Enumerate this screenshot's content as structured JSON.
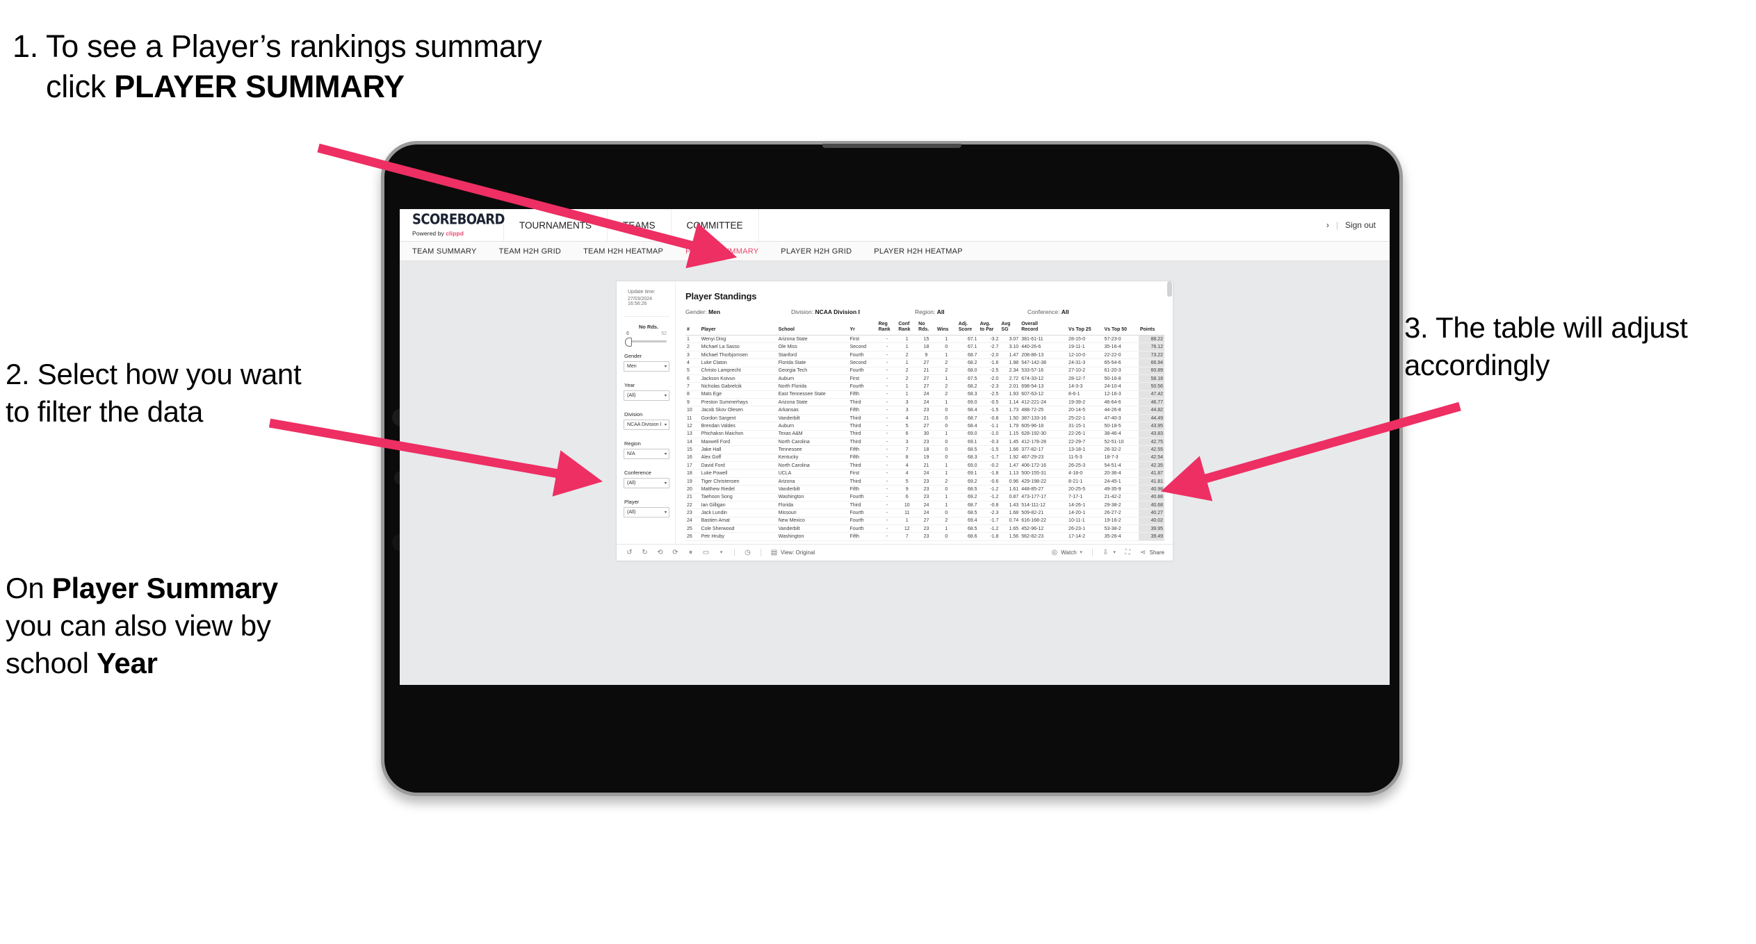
{
  "annotations": {
    "step1": {
      "number": "1.",
      "text_plain_a": "To see a Player’s rankings summary click ",
      "text_bold_a": "PLAYER SUMMARY"
    },
    "step2": {
      "line1": "2. Select how you want to filter the data",
      "p2_a": "On ",
      "p2_b": "Player Summary",
      "p2_c": " you can also view by school ",
      "p2_d": "Year"
    },
    "step3": {
      "text": "3. The table will adjust accordingly"
    },
    "arrow_color": "#ed2f63"
  },
  "app": {
    "brand": {
      "logo": "SCOREBOARD",
      "powered_prefix": "Powered by ",
      "powered_brand": "clippd"
    },
    "nav_tabs": [
      {
        "label": "TOURNAMENTS"
      },
      {
        "label": "TEAMS"
      },
      {
        "label": "COMMITTEE"
      }
    ],
    "account": {
      "chevron": "›",
      "separator": "|",
      "sign_out": "Sign out"
    },
    "sub_tabs": [
      {
        "label": "TEAM SUMMARY",
        "active": false
      },
      {
        "label": "TEAM H2H GRID",
        "active": false
      },
      {
        "label": "TEAM H2H HEATMAP",
        "active": false
      },
      {
        "label": "PLAYER SUMMARY",
        "active": true
      },
      {
        "label": "PLAYER H2H GRID",
        "active": false
      },
      {
        "label": "PLAYER H2H HEATMAP",
        "active": false
      }
    ],
    "accent_color": "#e8476f"
  },
  "viz": {
    "update": {
      "label": "Update time:",
      "value": "27/03/2024 16:56:26"
    },
    "title": "Player Standings",
    "meta": [
      {
        "label": "Gender:",
        "value": "Men"
      },
      {
        "label": "Division:",
        "value": "NCAA Division I"
      },
      {
        "label": "Region:",
        "value": "All"
      },
      {
        "label": "Conference:",
        "value": "All"
      }
    ],
    "filters": {
      "slider": {
        "label": "No Rds.",
        "min": "6",
        "max": "52"
      },
      "selects": [
        {
          "label": "Gender",
          "value": "Men"
        },
        {
          "label": "Year",
          "value": "(All)"
        },
        {
          "label": "Division",
          "value": "NCAA Division I"
        },
        {
          "label": "Region",
          "value": "N/A"
        },
        {
          "label": "Conference",
          "value": "(All)"
        },
        {
          "label": "Player",
          "value": "(All)"
        }
      ]
    },
    "bottom_bar": {
      "view_label": "View: Original",
      "watch_label": "Watch",
      "share_label": "Share"
    }
  },
  "chart_data": {
    "type": "table",
    "title": "Player Standings",
    "columns": [
      "#",
      "Player",
      "School",
      "Yr",
      "Reg Rank",
      "Conf Rank",
      "No Rds.",
      "Wins",
      "Adj. Score",
      "Avg. to Par",
      "Avg SG",
      "Overall Record",
      "Vs Top 25",
      "Vs Top 50",
      "Points"
    ],
    "rows": [
      [
        "1",
        "Wenyi Ding",
        "Arizona State",
        "First",
        "-",
        "1",
        "15",
        "1",
        "67.1",
        "-3.2",
        "3.07",
        "381-61-11",
        "28-15-0",
        "57-23-0",
        "88.22"
      ],
      [
        "2",
        "Michael La Sasso",
        "Ole Miss",
        "Second",
        "-",
        "1",
        "18",
        "0",
        "67.1",
        "-2.7",
        "3.10",
        "440-26-6",
        "19-11-1",
        "35-16-4",
        "76.12"
      ],
      [
        "3",
        "Michael Thorbjornsen",
        "Stanford",
        "Fourth",
        "-",
        "2",
        "9",
        "1",
        "68.7",
        "-2.0",
        "1.47",
        "208-86-13",
        "12-10-0",
        "22-22-0",
        "73.22"
      ],
      [
        "4",
        "Luke Claton",
        "Florida State",
        "Second",
        "-",
        "1",
        "27",
        "2",
        "68.2",
        "-1.6",
        "1.98",
        "547-142-38",
        "24-31-3",
        "65-54-6",
        "66.94"
      ],
      [
        "5",
        "Christo Lamprecht",
        "Georgia Tech",
        "Fourth",
        "-",
        "2",
        "21",
        "2",
        "68.0",
        "-2.5",
        "2.34",
        "533-57-16",
        "27-10-2",
        "61-20-3",
        "60.89"
      ],
      [
        "6",
        "Jackson Koivun",
        "Auburn",
        "First",
        "-",
        "2",
        "27",
        "1",
        "67.5",
        "-2.0",
        "2.72",
        "674-33-12",
        "28-12-7",
        "50-16-8",
        "58.18"
      ],
      [
        "7",
        "Nicholas Gabrelcik",
        "North Florida",
        "Fourth",
        "-",
        "1",
        "27",
        "2",
        "68.2",
        "-2.3",
        "2.01",
        "698-54-13",
        "14-3-3",
        "24-10-4",
        "50.56"
      ],
      [
        "8",
        "Mats Ege",
        "East Tennessee State",
        "Fifth",
        "-",
        "1",
        "24",
        "2",
        "68.3",
        "-2.5",
        "1.93",
        "607-63-12",
        "8-6-1",
        "12-16-3",
        "47.42"
      ],
      [
        "9",
        "Preston Summerhays",
        "Arizona State",
        "Third",
        "-",
        "3",
        "24",
        "1",
        "69.0",
        "-0.5",
        "1.14",
        "412-221-24",
        "19-39-2",
        "46-64-6",
        "46.77"
      ],
      [
        "10",
        "Jacob Skov Olesen",
        "Arkansas",
        "Fifth",
        "-",
        "3",
        "23",
        "0",
        "68.4",
        "-1.5",
        "1.73",
        "488-72-25",
        "20-14-5",
        "44-26-8",
        "44.82"
      ],
      [
        "11",
        "Gordon Sargent",
        "Vanderbilt",
        "Third",
        "-",
        "4",
        "21",
        "0",
        "68.7",
        "-0.8",
        "1.50",
        "387-133-16",
        "25-22-1",
        "47-40-3",
        "44.49"
      ],
      [
        "12",
        "Brendan Valdes",
        "Auburn",
        "Third",
        "-",
        "5",
        "27",
        "0",
        "68.4",
        "-1.1",
        "1.79",
        "605-96-18",
        "31-15-1",
        "50-18-5",
        "43.95"
      ],
      [
        "13",
        "Phichaksn Maichon",
        "Texas A&M",
        "Third",
        "-",
        "6",
        "30",
        "1",
        "69.0",
        "-1.0",
        "1.15",
        "628-192-30",
        "22-26-1",
        "38-46-4",
        "43.83"
      ],
      [
        "14",
        "Maxwell Ford",
        "North Carolina",
        "Third",
        "-",
        "3",
        "23",
        "0",
        "69.1",
        "-0.3",
        "1.45",
        "412-178-28",
        "22-29-7",
        "52-51-10",
        "42.75"
      ],
      [
        "15",
        "Jake Hall",
        "Tennessee",
        "Fifth",
        "-",
        "7",
        "18",
        "0",
        "68.5",
        "-1.5",
        "1.66",
        "377-82-17",
        "13-18-1",
        "26-32-2",
        "42.55"
      ],
      [
        "16",
        "Alex Goff",
        "Kentucky",
        "Fifth",
        "-",
        "8",
        "19",
        "0",
        "68.3",
        "-1.7",
        "1.92",
        "467-29-23",
        "11-5-3",
        "18-7-3",
        "42.54"
      ],
      [
        "17",
        "David Ford",
        "North Carolina",
        "Third",
        "-",
        "4",
        "21",
        "1",
        "69.0",
        "-0.2",
        "1.47",
        "406-172-16",
        "26-25-3",
        "54-51-4",
        "42.35"
      ],
      [
        "18",
        "Luke Powell",
        "UCLA",
        "First",
        "-",
        "4",
        "24",
        "1",
        "69.1",
        "-1.8",
        "1.13",
        "500-155-31",
        "4-18-0",
        "20-36-4",
        "41.87"
      ],
      [
        "19",
        "Tiger Christensen",
        "Arizona",
        "Third",
        "-",
        "5",
        "23",
        "2",
        "69.2",
        "-0.6",
        "0.96",
        "429-198-22",
        "8-21-1",
        "24-45-1",
        "41.81"
      ],
      [
        "20",
        "Matthew Riedel",
        "Vanderbilt",
        "Fifth",
        "-",
        "9",
        "23",
        "0",
        "68.5",
        "-1.2",
        "1.61",
        "448-85-27",
        "20-25-5",
        "49-35-9",
        "40.98"
      ],
      [
        "21",
        "Taehoon Song",
        "Washington",
        "Fourth",
        "-",
        "6",
        "23",
        "1",
        "69.2",
        "-1.2",
        "0.87",
        "473-177-17",
        "7-17-1",
        "21-42-2",
        "40.88"
      ],
      [
        "22",
        "Ian Gilligan",
        "Florida",
        "Third",
        "-",
        "10",
        "24",
        "1",
        "68.7",
        "-0.8",
        "1.43",
        "514-111-12",
        "14-26-1",
        "29-38-2",
        "40.68"
      ],
      [
        "23",
        "Jack Lundin",
        "Missouri",
        "Fourth",
        "-",
        "11",
        "24",
        "0",
        "68.5",
        "-2.3",
        "1.68",
        "509-82-21",
        "14-20-1",
        "26-27-2",
        "40.27"
      ],
      [
        "24",
        "Bastien Amat",
        "New Mexico",
        "Fourth",
        "-",
        "1",
        "27",
        "2",
        "69.4",
        "-1.7",
        "0.74",
        "616-168-22",
        "10-11-1",
        "19-16-2",
        "40.02"
      ],
      [
        "25",
        "Cole Sherwood",
        "Vanderbilt",
        "Fourth",
        "-",
        "12",
        "23",
        "1",
        "68.5",
        "-1.2",
        "1.65",
        "452-96-12",
        "26-23-1",
        "53-38-2",
        "39.95"
      ],
      [
        "26",
        "Petr Hruby",
        "Washington",
        "Fifth",
        "-",
        "7",
        "23",
        "0",
        "68.6",
        "-1.8",
        "1.56",
        "562-82-23",
        "17-14-2",
        "35-26-4",
        "39.49"
      ]
    ]
  }
}
